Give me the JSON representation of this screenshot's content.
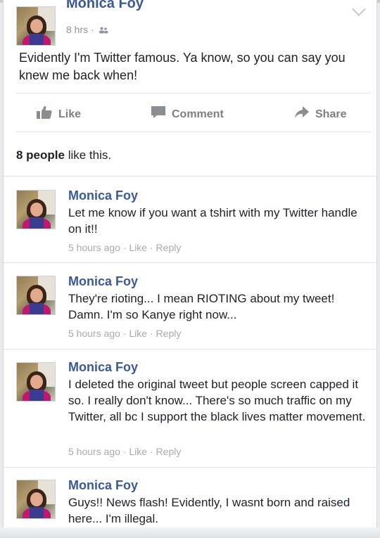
{
  "post": {
    "author": "Monica Foy",
    "time": "8 hrs",
    "separator": "·",
    "text": "Evidently I'm Twitter famous. Ya know, so you can say you knew me back when!"
  },
  "actions": {
    "like": "Like",
    "comment": "Comment",
    "share": "Share"
  },
  "likes": {
    "count_text": "8 people",
    "suffix": " like this."
  },
  "comments": [
    {
      "author": "Monica Foy",
      "text": "Let me know if you want a tshirt with my Twitter handle on it!!",
      "time": "5 hours ago",
      "like": "Like",
      "reply": "Reply"
    },
    {
      "author": "Monica Foy",
      "text": "They're rioting... I mean RIOTING about my tweet! Damn. I'm so Kanye right now...",
      "time": "5 hours ago",
      "like": "Like",
      "reply": "Reply"
    },
    {
      "author": "Monica Foy",
      "text": "I deleted the original tweet but people screen capped it so. I really don't know... There's so much traffic on my Twitter, all bc I support the black lives matter movement.",
      "time": "5 hours ago",
      "like": "Like",
      "reply": "Reply"
    },
    {
      "author": "Monica Foy",
      "text": "Guys!! News flash! Evidently, I wasnt born and raised here... I'm illegal."
    }
  ],
  "colors": {
    "name_blue": "#3b5998",
    "meta_gray": "#90949c",
    "text": "#1d2129"
  }
}
